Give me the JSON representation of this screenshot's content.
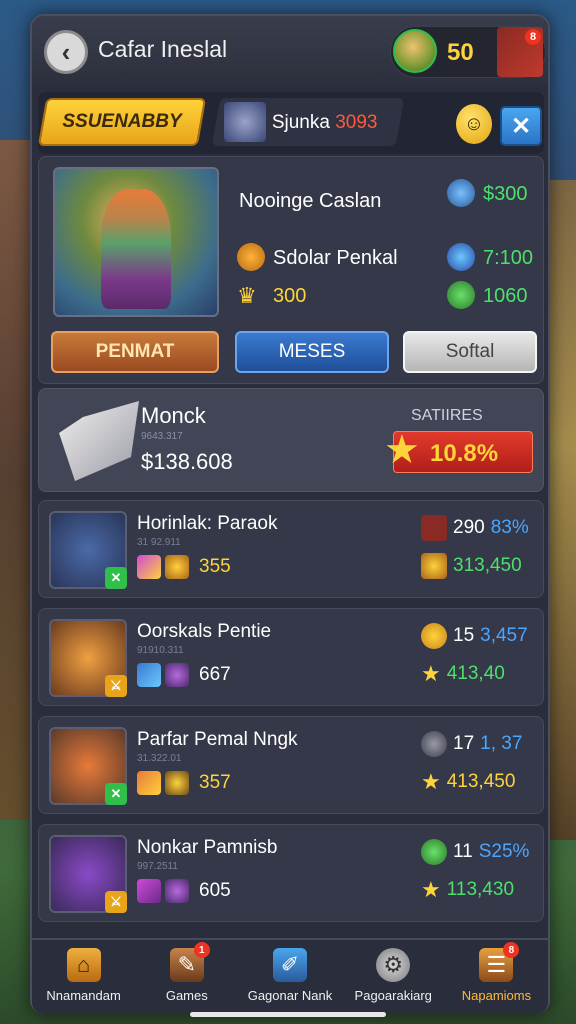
{
  "header": {
    "title": "Cafar Ineslal",
    "back_icon": "‹",
    "currency_amount": "50",
    "chest_badge": "8"
  },
  "tabs": {
    "active_label": "SSUENABBY",
    "second_label": "Sjunka",
    "second_number": "3093",
    "emoji": "☺",
    "close": "✕"
  },
  "hero": {
    "name": "Nooinge Caslan",
    "stat1_value": "$300",
    "stat2_label": "Sdolar Penkal",
    "stat2_value": "7:100",
    "stat3_value": "300",
    "stat4_value": "1060",
    "buttons": [
      "PENMAT",
      "MESES",
      "Softal"
    ]
  },
  "featured": {
    "name": "Monck",
    "sub": "9643.317",
    "price": "$138.608",
    "label": "SATIIRES",
    "percent": "10.8%"
  },
  "rows": [
    {
      "name": "Horinlak: Paraok",
      "sub": "31 92.911",
      "level": "355",
      "right_top_a": "290",
      "right_top_b": "83%",
      "right_bot": "313,450",
      "colors": [
        "#4a6aa8",
        "#2a3558"
      ]
    },
    {
      "name": "Oorskals Pentie",
      "sub": "91910.311",
      "level": "667",
      "right_top_a": "15",
      "right_top_b": "3,457",
      "right_bot": "413,40",
      "colors": [
        "#f0a040",
        "#6a3a20"
      ]
    },
    {
      "name": "Parfar Pemal Nngk",
      "sub": "31.322.01",
      "level": "357",
      "right_top_a": "17",
      "right_top_b": "1, 37",
      "right_bot": "413,450",
      "colors": [
        "#e87a3a",
        "#5a3a2a"
      ]
    },
    {
      "name": "Nonkar Pamnisb",
      "sub": "997.2511",
      "level": "605",
      "right_top_a": "11",
      "right_top_b": "S25%",
      "right_bot": "113,430",
      "colors": [
        "#8a4ac8",
        "#3a2a58"
      ]
    }
  ],
  "nav": [
    {
      "label": "Nnamandam",
      "icon": "⌂",
      "badge": ""
    },
    {
      "label": "Games",
      "icon": "✎",
      "badge": "1"
    },
    {
      "label": "Gagonar Nank",
      "icon": "✐",
      "badge": ""
    },
    {
      "label": "Pagoarakiarg",
      "icon": "⚙",
      "badge": ""
    },
    {
      "label": "Napamioms",
      "icon": "☰",
      "badge": "8"
    }
  ]
}
